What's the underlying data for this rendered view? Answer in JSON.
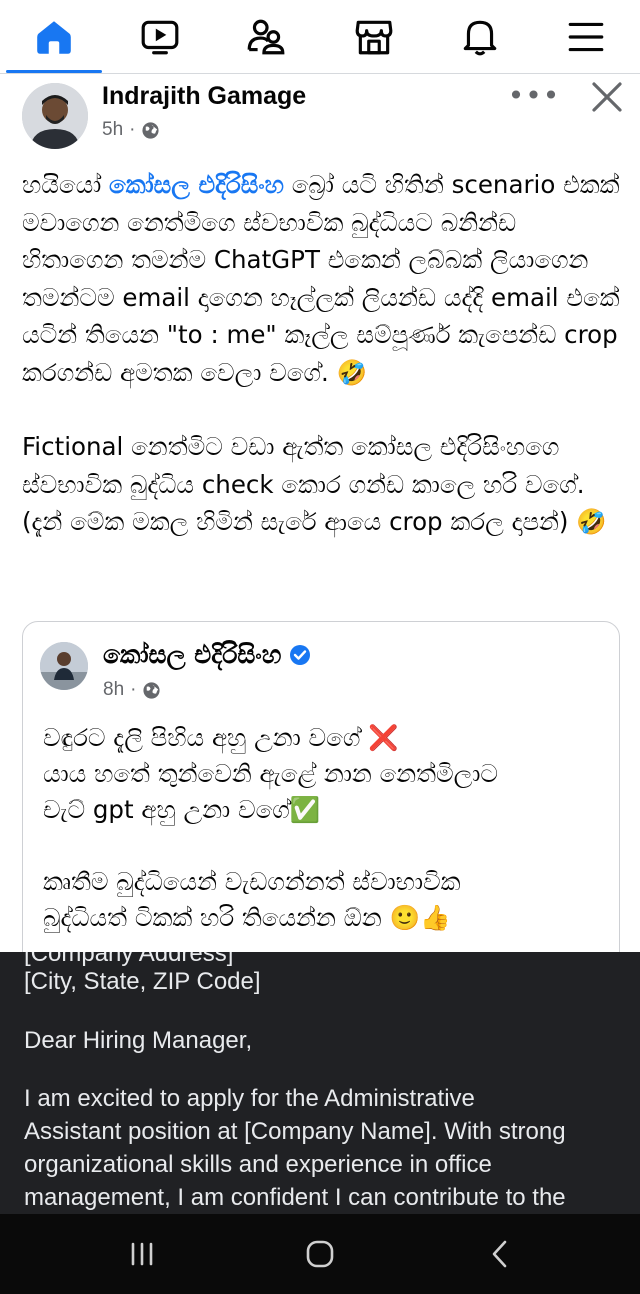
{
  "nav": {
    "items": [
      {
        "name": "home",
        "icon": "home-icon",
        "active": true
      },
      {
        "name": "video",
        "icon": "video-icon",
        "active": false
      },
      {
        "name": "friends",
        "icon": "friends-icon",
        "active": false
      },
      {
        "name": "marketplace",
        "icon": "marketplace-icon",
        "active": false
      },
      {
        "name": "notifications",
        "icon": "bell-icon",
        "active": false
      },
      {
        "name": "menu",
        "icon": "menu-icon",
        "active": false
      }
    ],
    "accent": "#1877f2"
  },
  "post": {
    "author": "Indrajith Gamage",
    "time": "5h",
    "separator": "·",
    "more_label": "•••",
    "paragraph1": {
      "prefix": "හයියෝ ",
      "mention": "කෝසල එදිරිසිංහ",
      "rest": " බ්‍රෝ යටි හිතින් scenario එකක් මවාගෙන නෙත්මිගෙ ස්වභාවික බුද්ධියට බනින්ඩ හිතාගෙන තමන්ම ChatGPT එකෙන් ලබ්බක් ලියාගෙන තමන්ටම email දාගෙන හෑල්ලක් ලියන්ඩ යද්දි email එකේ යටින් තියෙන \"to : me\" කෑල්ල සම්පූර්ණ කැපෙන්ඩ crop කරගන්ඩ අමතක වෙලා වගේ. 🤣"
    },
    "paragraph2": "Fictional නෙත්මිට වඩා ඇත්ත කෝසල එදිරිසිංහගෙ ස්වභාවික බුද්ධිය check කොර ගන්ඩ කාලෙ හරි වගේ. (දැන් මේක මකල හිමින් සැරේ ආයෙ crop කරල දාපන්) 🤣"
  },
  "shared": {
    "author": "කෝසල එදිරිසිංහ",
    "time": "8h",
    "separator": "·",
    "paragraph1_lines": [
      "වඳුරට දැලි පිහිය අහු උනා වගේ ❌",
      "යාය හතේ තුන්වෙනි ඇළේ නාන නෙත්මිලාට",
      "චැට් gpt අහු උනා වගේ✅"
    ],
    "paragraph2_lines": [
      "කෘතීම බුද්ධියෙන් වැඩගන්නත් ස්වාභාවික",
      "බුද්ධියත් ටිකක් හරි තියෙන්න ඕන 🙂👍"
    ]
  },
  "overlay": {
    "cut_line": "[Company Address]",
    "lines": [
      "[City, State, ZIP Code]",
      "Dear Hiring Manager,",
      "I am excited to apply for the Administrative",
      "Assistant position at [Company Name]. With strong",
      "organizational skills and experience in office",
      "management, I am confident I can contribute to the"
    ]
  },
  "system_nav": {
    "buttons": [
      "recents-icon",
      "home-circle-icon",
      "back-icon"
    ]
  }
}
